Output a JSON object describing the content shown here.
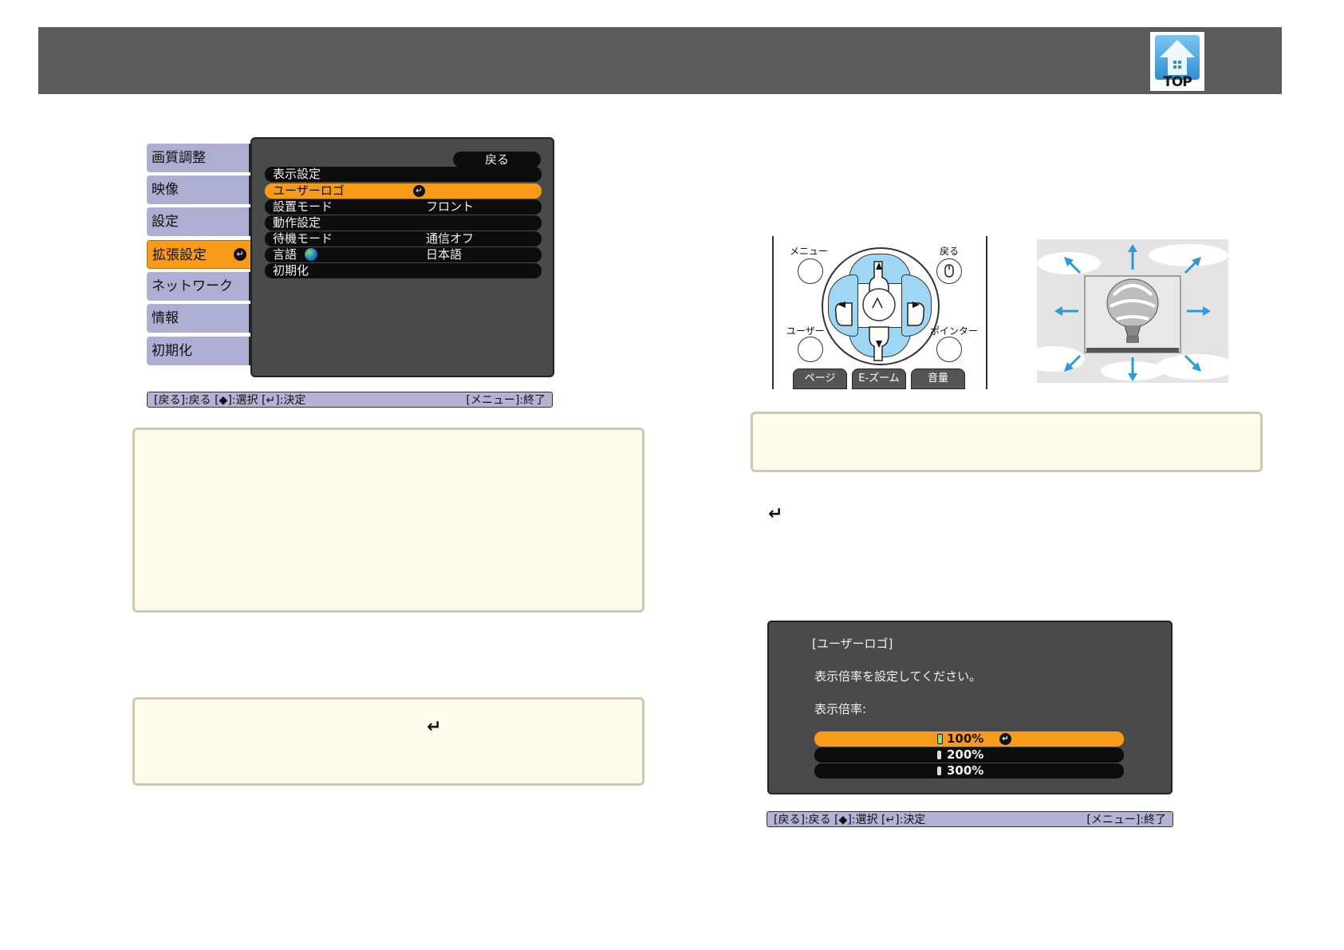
{
  "header": {
    "logo_label": "TOP"
  },
  "menu1": {
    "tabs": [
      {
        "label": "画質調整"
      },
      {
        "label": "映像"
      },
      {
        "label": "設定"
      },
      {
        "label": "拡張設定"
      },
      {
        "label": "ネットワーク"
      },
      {
        "label": "情報"
      },
      {
        "label": "初期化"
      }
    ],
    "back_label": "戻る",
    "rows": [
      {
        "label": "表示設定",
        "value": ""
      },
      {
        "label": "ユーザーロゴ",
        "value": ""
      },
      {
        "label": "設置モード",
        "value": "フロント"
      },
      {
        "label": "動作設定",
        "value": ""
      },
      {
        "label": "待機モード",
        "value": "通信オフ"
      },
      {
        "label": "言語",
        "value": "日本語"
      },
      {
        "label": "初期化",
        "value": ""
      }
    ],
    "enter_glyph": "↵",
    "help_left": "[戻る]:戻る [◆]:選択 [↵]:決定",
    "help_right": "[メニュー]:終了"
  },
  "remote": {
    "menu_label": "メニュー",
    "back_label": "戻る",
    "user_label": "ユーザー",
    "pointer_label": "ポインター",
    "keys": [
      "ページ",
      "E-ズーム",
      "音量"
    ]
  },
  "note2": {
    "return_icon": "↵"
  },
  "note3": {
    "return_icon": "↵"
  },
  "menu2": {
    "title": "[ユーザーロゴ]",
    "instruction": "表示倍率を設定してください。",
    "zoom_label": "表示倍率:",
    "options": [
      "100%",
      "200%",
      "300%"
    ],
    "enter_glyph": "↵",
    "help_left": "[戻る]:戻る [◆]:選択 [↵]:決定",
    "help_right": "[メニュー]:終了"
  },
  "colors": {
    "accent": "#f89a1a",
    "tab": "#aeaed2",
    "panel": "#4a4a4a",
    "note_bg": "#fffcec"
  }
}
